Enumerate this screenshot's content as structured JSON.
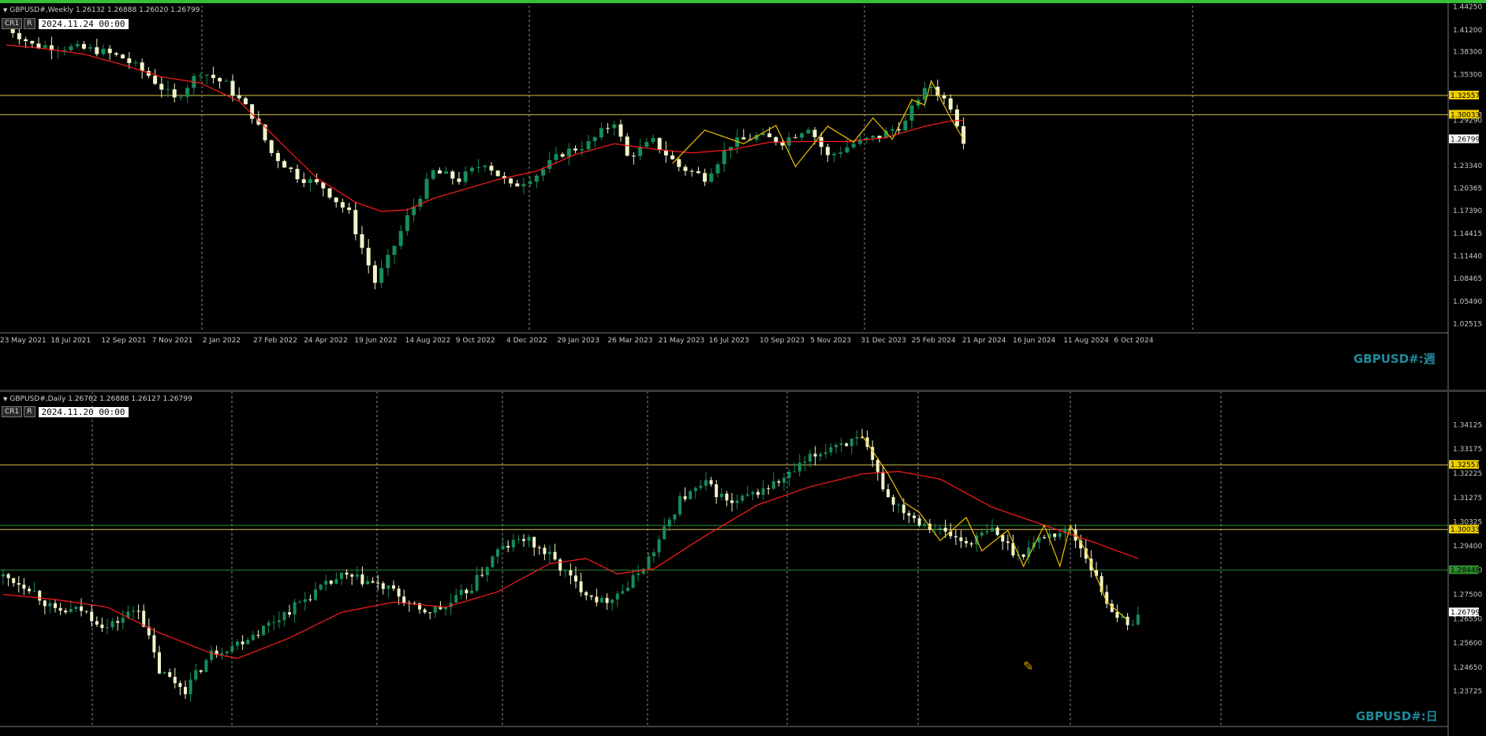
{
  "colors": {
    "bg": "#000000",
    "bull": "#168c5a",
    "bear": "#f0f5c8",
    "ma": "#ff1c1c",
    "zigzag": "#f0c000",
    "hline_yellow": "#d4c24a",
    "hline_green": "#2e8b2e",
    "grid": "#8c8c8c",
    "axis_text": "#c8c8c8",
    "watermark": "#1f8a9c",
    "top_border": "#34c234"
  },
  "weekly": {
    "header": "GBPUSD#,Weekly  1.26132 1.26888 1.26020 1.26799",
    "badge1": "CR1",
    "badge2": "R",
    "date": "2024.11.24 00:00",
    "watermark": "GBPUSD#:週",
    "icons": {
      "collapse": "triangle-down-icon"
    }
  },
  "daily": {
    "header": "GBPUSD#,Daily  1.26762 1.26888 1.26127 1.26799",
    "badge1": "CR1",
    "badge2": "R",
    "date": "2024.11.20 00:00",
    "watermark": "GBPUSD#:日",
    "cursor_icon": "crosshair-pencil-icon"
  },
  "chart_data": [
    {
      "type": "candlestick",
      "title": "GBPUSD#,Weekly",
      "ylim": [
        1.0235,
        1.446
      ],
      "y_ticks": [
        "1.44250",
        "1.41200",
        "1.38300",
        "1.35300",
        "1.30033",
        "1.29290",
        "1.23340",
        "1.20365",
        "1.17390",
        "1.14415",
        "1.11440",
        "1.08465",
        "1.05490",
        "1.02515"
      ],
      "x_ticks": [
        "23 May 2021",
        "18 Jul 2021",
        "12 Sep 2021",
        "7 Nov 2021",
        "2 Jan 2022",
        "27 Feb 2022",
        "24 Apr 2022",
        "19 Jun 2022",
        "14 Aug 2022",
        "9 Oct 2022",
        "4 Dec 2022",
        "29 Jan 2023",
        "26 Mar 2023",
        "21 May 2023",
        "16 Jul 2023",
        "10 Sep 2023",
        "5 Nov 2023",
        "31 Dec 2023",
        "25 Feb 2024",
        "21 Apr 2024",
        "16 Jun 2024",
        "11 Aug 2024",
        "6 Oct 2024"
      ],
      "hlines": [
        {
          "value": 1.32557,
          "label": "1.32557",
          "color": "yellow"
        },
        {
          "value": 1.30033,
          "label": "1.30033",
          "color": "yellow"
        }
      ],
      "current_price": "1.26799",
      "close_path": [
        [
          0,
          1.417
        ],
        [
          4,
          1.392
        ],
        [
          9,
          1.389
        ],
        [
          14,
          1.385
        ],
        [
          18,
          1.375
        ],
        [
          22,
          1.352
        ],
        [
          26,
          1.32
        ],
        [
          30,
          1.358
        ],
        [
          34,
          1.34
        ],
        [
          38,
          1.3
        ],
        [
          41,
          1.25
        ],
        [
          45,
          1.22
        ],
        [
          49,
          1.205
        ],
        [
          53,
          1.17
        ],
        [
          57,
          1.08
        ],
        [
          59,
          1.11
        ],
        [
          62,
          1.165
        ],
        [
          66,
          1.225
        ],
        [
          70,
          1.215
        ],
        [
          74,
          1.238
        ],
        [
          78,
          1.205
        ],
        [
          82,
          1.222
        ],
        [
          86,
          1.25
        ],
        [
          90,
          1.262
        ],
        [
          94,
          1.292
        ],
        [
          96,
          1.245
        ],
        [
          100,
          1.265
        ],
        [
          104,
          1.232
        ],
        [
          108,
          1.218
        ],
        [
          112,
          1.262
        ],
        [
          116,
          1.272
        ],
        [
          120,
          1.265
        ],
        [
          124,
          1.285
        ],
        [
          127,
          1.245
        ],
        [
          131,
          1.262
        ],
        [
          135,
          1.272
        ],
        [
          139,
          1.29
        ],
        [
          141,
          1.323
        ],
        [
          143,
          1.338
        ],
        [
          146,
          1.312
        ],
        [
          148,
          1.268
        ]
      ],
      "ma_path": [
        [
          0,
          1.392
        ],
        [
          6,
          1.387
        ],
        [
          12,
          1.38
        ],
        [
          18,
          1.366
        ],
        [
          24,
          1.35
        ],
        [
          30,
          1.342
        ],
        [
          36,
          1.318
        ],
        [
          42,
          1.267
        ],
        [
          48,
          1.217
        ],
        [
          54,
          1.185
        ],
        [
          58,
          1.173
        ],
        [
          62,
          1.175
        ],
        [
          66,
          1.19
        ],
        [
          70,
          1.2
        ],
        [
          76,
          1.215
        ],
        [
          82,
          1.226
        ],
        [
          88,
          1.248
        ],
        [
          94,
          1.262
        ],
        [
          100,
          1.255
        ],
        [
          106,
          1.25
        ],
        [
          112,
          1.254
        ],
        [
          118,
          1.264
        ],
        [
          124,
          1.265
        ],
        [
          130,
          1.265
        ],
        [
          136,
          1.27
        ],
        [
          142,
          1.285
        ],
        [
          146,
          1.292
        ],
        [
          148,
          1.293
        ]
      ],
      "zigzag": [
        [
          103,
          1.236
        ],
        [
          108,
          1.28
        ],
        [
          114,
          1.262
        ],
        [
          119,
          1.286
        ],
        [
          122,
          1.232
        ],
        [
          127,
          1.285
        ],
        [
          131,
          1.264
        ],
        [
          134,
          1.296
        ],
        [
          137,
          1.268
        ],
        [
          140,
          1.32
        ],
        [
          142,
          1.313
        ],
        [
          143,
          1.345
        ],
        [
          146,
          1.296
        ],
        [
          148,
          1.268
        ]
      ]
    },
    {
      "type": "candlestick",
      "title": "GBPUSD#,Daily",
      "ylim": [
        1.2265,
        1.3512
      ],
      "y_ticks": [
        "1.34125",
        "1.33175",
        "1.32225",
        "1.31275",
        "1.30325",
        "1.29400",
        "1.28450",
        "1.27500",
        "1.26550",
        "1.25600",
        "1.24650",
        "1.23725"
      ],
      "hlines": [
        {
          "value": 1.32557,
          "label": "1.32557",
          "color": "yellow"
        },
        {
          "value": 1.30033,
          "label": "1.30033",
          "color": "yellow"
        },
        {
          "value": 1.3019,
          "label": "",
          "color": "green"
        },
        {
          "value": 1.28448,
          "label": "1.28448",
          "color": "green"
        }
      ],
      "current_price": "1.26799",
      "close_path": [
        [
          0,
          1.282
        ],
        [
          5,
          1.278
        ],
        [
          10,
          1.268
        ],
        [
          15,
          1.269
        ],
        [
          20,
          1.262
        ],
        [
          26,
          1.27
        ],
        [
          30,
          1.245
        ],
        [
          35,
          1.238
        ],
        [
          40,
          1.252
        ],
        [
          45,
          1.256
        ],
        [
          50,
          1.262
        ],
        [
          55,
          1.269
        ],
        [
          60,
          1.276
        ],
        [
          65,
          1.282
        ],
        [
          70,
          1.28
        ],
        [
          75,
          1.276
        ],
        [
          80,
          1.268
        ],
        [
          85,
          1.27
        ],
        [
          90,
          1.278
        ],
        [
          95,
          1.292
        ],
        [
          100,
          1.297
        ],
        [
          105,
          1.29
        ],
        [
          110,
          1.279
        ],
        [
          115,
          1.272
        ],
        [
          120,
          1.278
        ],
        [
          125,
          1.292
        ],
        [
          130,
          1.312
        ],
        [
          135,
          1.318
        ],
        [
          140,
          1.31
        ],
        [
          145,
          1.315
        ],
        [
          150,
          1.32
        ],
        [
          155,
          1.328
        ],
        [
          160,
          1.334
        ],
        [
          165,
          1.335
        ],
        [
          170,
          1.313
        ],
        [
          175,
          1.305
        ],
        [
          180,
          1.3
        ],
        [
          185,
          1.295
        ],
        [
          190,
          1.3
        ],
        [
          195,
          1.29
        ],
        [
          200,
          1.298
        ],
        [
          205,
          1.3
        ],
        [
          208,
          1.29
        ],
        [
          212,
          1.272
        ],
        [
          216,
          1.262
        ],
        [
          218,
          1.268
        ]
      ],
      "ma_path": [
        [
          0,
          1.275
        ],
        [
          10,
          1.273
        ],
        [
          20,
          1.27
        ],
        [
          30,
          1.26
        ],
        [
          40,
          1.252
        ],
        [
          45,
          1.25
        ],
        [
          55,
          1.258
        ],
        [
          65,
          1.268
        ],
        [
          75,
          1.272
        ],
        [
          85,
          1.27
        ],
        [
          95,
          1.276
        ],
        [
          105,
          1.287
        ],
        [
          112,
          1.289
        ],
        [
          118,
          1.283
        ],
        [
          125,
          1.285
        ],
        [
          135,
          1.298
        ],
        [
          145,
          1.31
        ],
        [
          155,
          1.317
        ],
        [
          165,
          1.322
        ],
        [
          172,
          1.323
        ],
        [
          180,
          1.32
        ],
        [
          190,
          1.309
        ],
        [
          200,
          1.302
        ],
        [
          210,
          1.295
        ],
        [
          218,
          1.289
        ]
      ],
      "zigzag": [
        [
          165,
          1.337
        ],
        [
          170,
          1.322
        ],
        [
          173,
          1.311
        ],
        [
          176,
          1.307
        ],
        [
          180,
          1.296
        ],
        [
          185,
          1.305
        ],
        [
          188,
          1.292
        ],
        [
          193,
          1.3
        ],
        [
          196,
          1.286
        ],
        [
          200,
          1.302
        ],
        [
          203,
          1.286
        ],
        [
          205,
          1.302
        ],
        [
          208,
          1.292
        ],
        [
          212,
          1.272
        ],
        [
          216,
          1.265
        ]
      ]
    }
  ]
}
